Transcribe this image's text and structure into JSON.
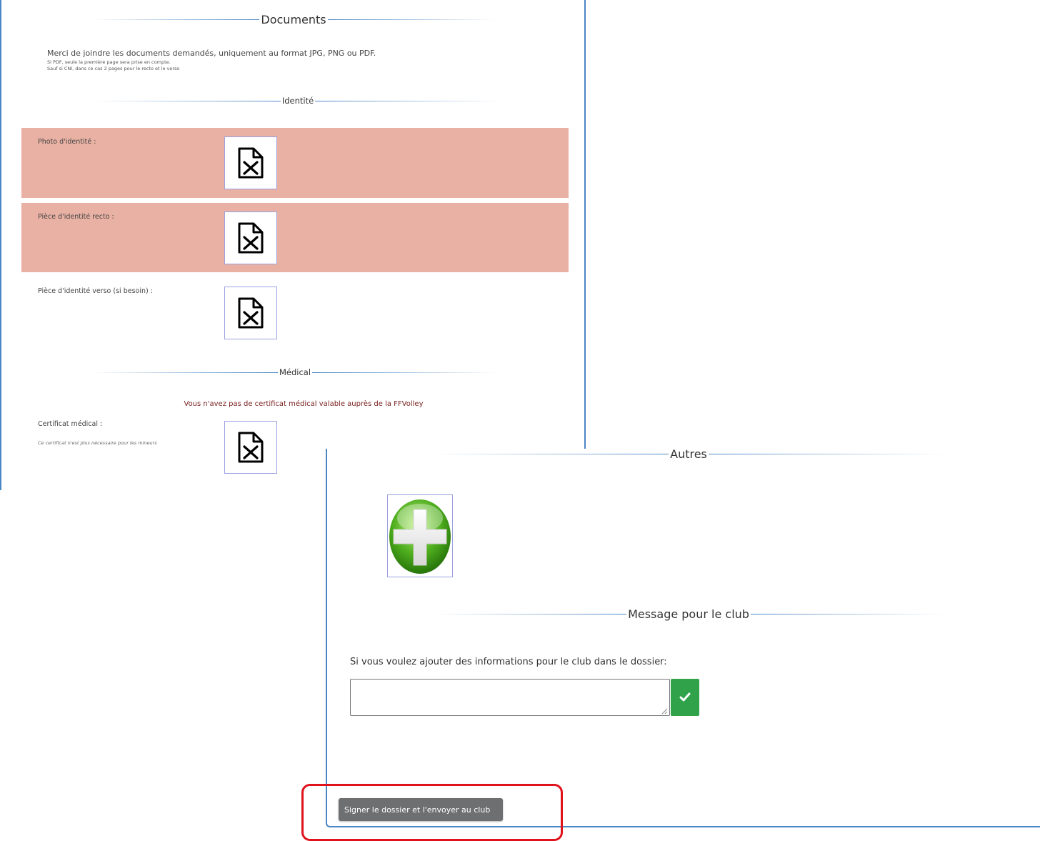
{
  "documents": {
    "title": "Documents",
    "intro_main": "Merci de joindre les documents demandés, uniquement au format JPG, PNG ou PDF.",
    "intro_line2": "Si PDF, seule la première page sera prise en compte.",
    "intro_line3": "Sauf si CNI, dans ce cas 2 pages pour le recto et le verso"
  },
  "identity": {
    "title": "Identité",
    "items": [
      {
        "label": "Photo d'identité :",
        "status": "missing"
      },
      {
        "label": "Pièce d'identité recto :",
        "status": "missing"
      },
      {
        "label": "Pièce d'identité verso (si besoin) :",
        "status": "optional"
      }
    ]
  },
  "medical": {
    "title": "Médical",
    "warning": "Vous n'avez pas de certificat médical valable auprès de la FFVolley",
    "certificate_label": "Certificat médical :",
    "certificate_note": "Ce certificat n'est plus nécessaire pour les mineurs"
  },
  "others": {
    "title": "Autres"
  },
  "club_message": {
    "title": "Message pour le club",
    "prompt": "Si vous voulez ajouter des informations pour le club dans le dossier:",
    "value": ""
  },
  "submit": {
    "label": "Signer le dossier et l'envoyer au club"
  },
  "colors": {
    "accent_border": "#4a86c4",
    "missing_row": "#e9b1a3",
    "warning_text": "#7a1f1f",
    "confirm_button": "#2fa24a",
    "highlight": "#e0121c"
  },
  "icons": [
    "missing-file-icon",
    "add-plus-icon",
    "checkmark-icon",
    "resize-grip-icon"
  ]
}
